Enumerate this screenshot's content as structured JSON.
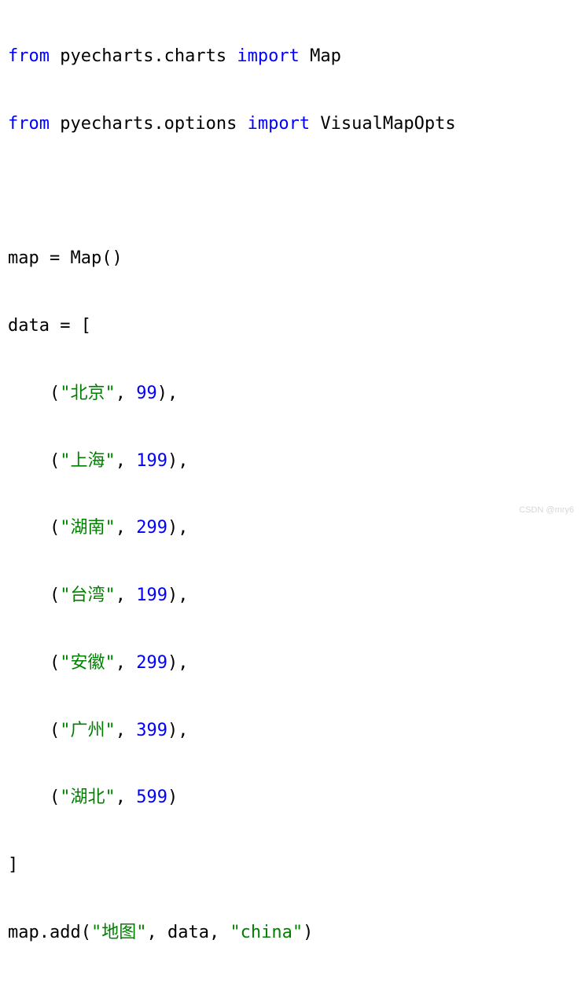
{
  "code": {
    "line1": {
      "kw1": "from",
      "p1": " pyecharts.charts ",
      "kw2": "import",
      "p2": " Map"
    },
    "line2": {
      "kw1": "from",
      "p1": " pyecharts.options ",
      "kw2": "import",
      "p2": " VisualMapOpts"
    },
    "line3": "",
    "line4": "map = Map()",
    "line5": "data = [",
    "line6": {
      "indent": "    (",
      "str": "\"北京\"",
      "comma": ", ",
      "num": "99",
      "end": "),"
    },
    "line7": {
      "indent": "    (",
      "str": "\"上海\"",
      "comma": ", ",
      "num": "199",
      "end": "),"
    },
    "line8": {
      "indent": "    (",
      "str": "\"湖南\"",
      "comma": ", ",
      "num": "299",
      "end": "),"
    },
    "line9": {
      "indent": "    (",
      "str": "\"台湾\"",
      "comma": ", ",
      "num": "199",
      "end": "),"
    },
    "line10": {
      "indent": "    (",
      "str": "\"安徽\"",
      "comma": ", ",
      "num": "299",
      "end": "),"
    },
    "line11": {
      "indent": "    (",
      "str": "\"广州\"",
      "comma": ", ",
      "num": "399",
      "end": "),"
    },
    "line12": {
      "indent": "    (",
      "str": "\"湖北\"",
      "comma": ", ",
      "num": "599",
      "end": ")"
    },
    "line13": "]",
    "line14": {
      "p1": "map.add(",
      "str1": "\"地图\"",
      "p2": ", data, ",
      "str2": "\"china\"",
      "p3": ")"
    }
  },
  "watermark": "CSDN @mry6",
  "chart_data": {
    "type": "table",
    "title": "Python code snippet using pyecharts Map",
    "imports": [
      "pyecharts.charts.Map",
      "pyecharts.options.VisualMapOpts"
    ],
    "variable": "data",
    "rows": [
      {
        "region": "北京",
        "value": 99
      },
      {
        "region": "上海",
        "value": 199
      },
      {
        "region": "湖南",
        "value": 299
      },
      {
        "region": "台湾",
        "value": 199
      },
      {
        "region": "安徽",
        "value": 299
      },
      {
        "region": "广州",
        "value": 399
      },
      {
        "region": "湖北",
        "value": 599
      }
    ],
    "call": "map.add(\"地图\", data, \"china\")"
  }
}
